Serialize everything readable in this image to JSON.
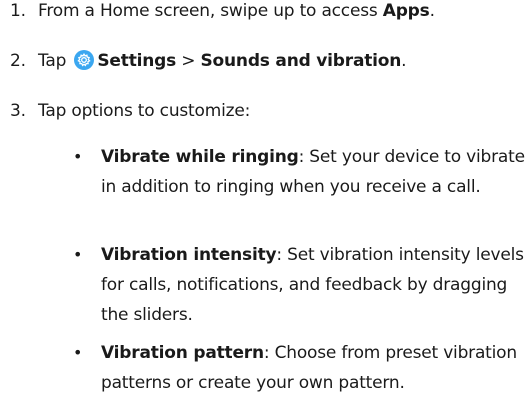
{
  "steps": [
    {
      "number": "1.",
      "prefix": "From a Home screen, swipe up to access ",
      "bold": "Apps",
      "suffix": "."
    },
    {
      "number": "2.",
      "prefix": "Tap ",
      "icon": "settings-gear-icon",
      "bold_settings": "Settings",
      "separator": " > ",
      "bold_target": "Sounds and vibration",
      "suffix": "."
    },
    {
      "number": "3.",
      "text": "Tap options to customize:"
    }
  ],
  "options": [
    {
      "bullet": "•",
      "title": "Vibrate while ringing",
      "description": ": Set your device to vibrate in addition to ringing when you receive a call."
    },
    {
      "bullet": "•",
      "title": "Vibration intensity",
      "description": ": Set vibration intensity levels for calls, notifications, and feedback by dragging the sliders."
    },
    {
      "bullet": "•",
      "title": "Vibration pattern",
      "description": ": Choose from preset vibration patterns or create your own pattern."
    }
  ],
  "colors": {
    "text": "#1a1a1a",
    "settings_icon": "#3ba7f0"
  }
}
